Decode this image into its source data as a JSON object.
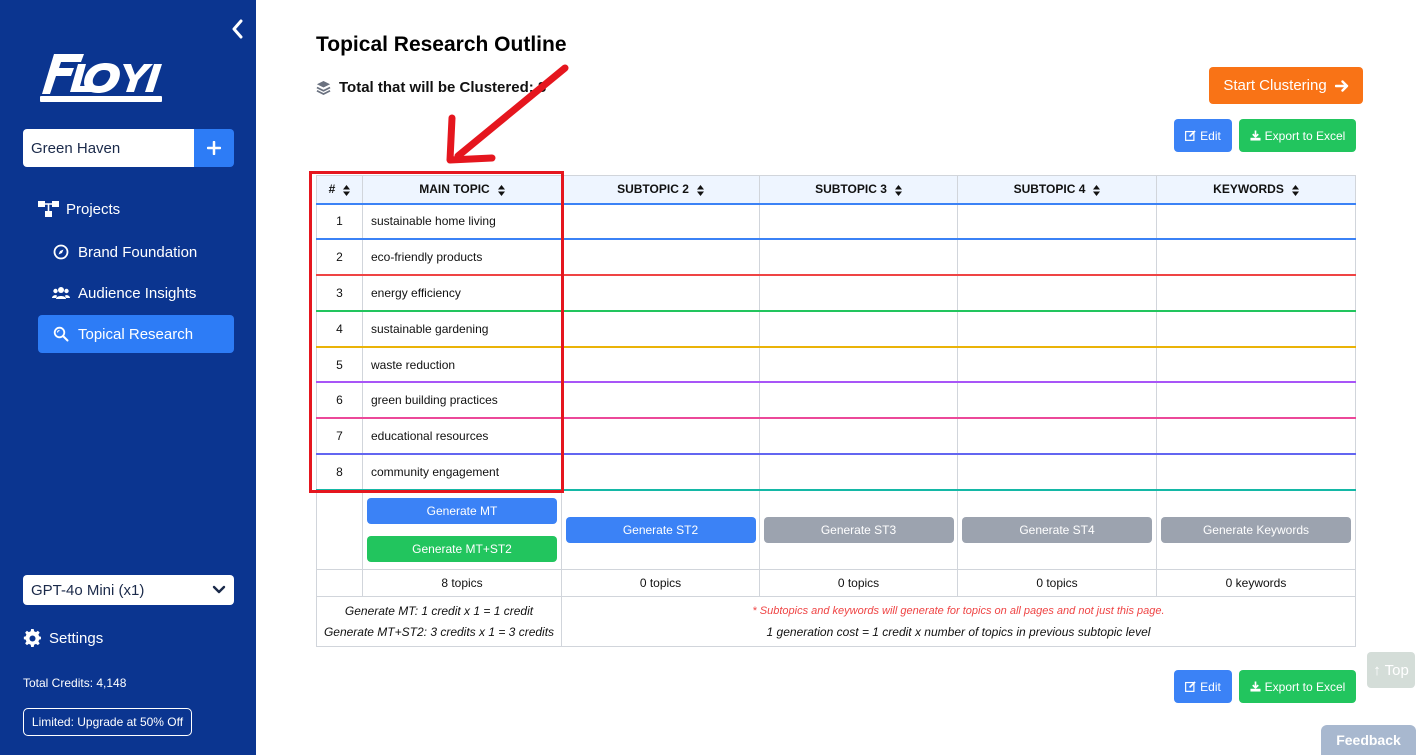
{
  "sidebar": {
    "project": "Green Haven",
    "nav": {
      "projects": "Projects",
      "brand": "Brand Foundation",
      "audience": "Audience Insights",
      "topical": "Topical Research"
    },
    "model": "GPT-4o Mini (x1)",
    "settings": "Settings",
    "credits": "Total Credits: 4,148",
    "upgrade": "Limited: Upgrade at 50% Off"
  },
  "main": {
    "title": "Topical Research Outline",
    "cluster_total": "Total that will be Clustered: 8",
    "start_clustering": "Start Clustering",
    "edit": "Edit",
    "export": "Export to Excel"
  },
  "table": {
    "headers": [
      "#",
      "MAIN TOPIC",
      "SUBTOPIC 2",
      "SUBTOPIC 3",
      "SUBTOPIC 4",
      "KEYWORDS"
    ],
    "rows": [
      {
        "num": "1",
        "topic": "sustainable home living"
      },
      {
        "num": "2",
        "topic": "eco-friendly products"
      },
      {
        "num": "3",
        "topic": "energy efficiency"
      },
      {
        "num": "4",
        "topic": "sustainable gardening"
      },
      {
        "num": "5",
        "topic": "waste reduction"
      },
      {
        "num": "6",
        "topic": "green building practices"
      },
      {
        "num": "7",
        "topic": "educational resources"
      },
      {
        "num": "8",
        "topic": "community engagement"
      }
    ],
    "buttons": {
      "gen_mt": "Generate MT",
      "gen_mt_st2": "Generate MT+ST2",
      "gen_st2": "Generate ST2",
      "gen_st3": "Generate ST3",
      "gen_st4": "Generate ST4",
      "gen_kw": "Generate Keywords"
    },
    "counts": [
      "8 topics",
      "0 topics",
      "0 topics",
      "0 topics",
      "0 keywords"
    ],
    "notes": {
      "mt_cost": "Generate MT: 1 credit x 1 = 1 credit",
      "mt_st2_cost": "Generate MT+ST2: 3 credits x 1 = 3 credits",
      "warning": "* Subtopics and keywords will generate for topics on all pages and not just this page.",
      "gen_cost": "1 generation cost = 1 credit x number of topics in previous subtopic level"
    }
  },
  "floating": {
    "top": "↑ Top",
    "feedback": "Feedback"
  },
  "colors": {
    "sidebar": "#0b3590",
    "accent_blue": "#2d7cf6",
    "orange": "#f97316",
    "green": "#22c55e",
    "annotation_red": "#e5161e"
  }
}
